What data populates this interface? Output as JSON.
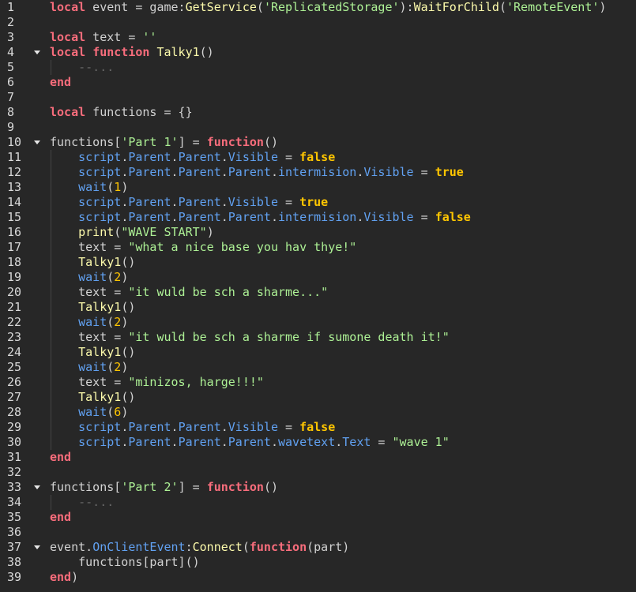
{
  "editor": {
    "colors": {
      "background": "#272727",
      "keyword": "#f86d7c",
      "boolean": "#ffc600",
      "function": "#fdfbac",
      "property": "#61a1f1",
      "string": "#adf195",
      "number": "#ffc600",
      "comment": "#666666",
      "text": "#d2d2d2",
      "line_number": "#d8d8d8"
    },
    "fold_lines": [
      4,
      10,
      33,
      37
    ],
    "lines": [
      {
        "n": "1",
        "tokens": [
          [
            "kw",
            "local"
          ],
          [
            "plain",
            " event = game:"
          ],
          [
            "fn",
            "GetService"
          ],
          [
            "plain",
            "("
          ],
          [
            "str",
            "'ReplicatedStorage'"
          ],
          [
            "plain",
            "):"
          ],
          [
            "fn",
            "WaitForChild"
          ],
          [
            "plain",
            "("
          ],
          [
            "str",
            "'RemoteEvent'"
          ],
          [
            "plain",
            ")"
          ]
        ]
      },
      {
        "n": "2",
        "tokens": []
      },
      {
        "n": "3",
        "tokens": [
          [
            "kw",
            "local"
          ],
          [
            "plain",
            " text = "
          ],
          [
            "str",
            "''"
          ]
        ]
      },
      {
        "n": "4",
        "tokens": [
          [
            "kw",
            "local"
          ],
          [
            "plain",
            " "
          ],
          [
            "kw",
            "function"
          ],
          [
            "plain",
            " "
          ],
          [
            "fn",
            "Talky1"
          ],
          [
            "plain",
            "()"
          ]
        ]
      },
      {
        "n": "5",
        "tokens": [
          [
            "plain",
            "    "
          ],
          [
            "cmt",
            "--..."
          ]
        ]
      },
      {
        "n": "6",
        "tokens": [
          [
            "kw",
            "end"
          ]
        ]
      },
      {
        "n": "7",
        "tokens": []
      },
      {
        "n": "8",
        "tokens": [
          [
            "kw",
            "local"
          ],
          [
            "plain",
            " functions = {}"
          ]
        ]
      },
      {
        "n": "9",
        "tokens": []
      },
      {
        "n": "10",
        "tokens": [
          [
            "plain",
            "functions["
          ],
          [
            "str",
            "'Part 1'"
          ],
          [
            "plain",
            "] = "
          ],
          [
            "kw",
            "function"
          ],
          [
            "plain",
            "()"
          ]
        ]
      },
      {
        "n": "11",
        "tokens": [
          [
            "plain",
            "    "
          ],
          [
            "prop",
            "script"
          ],
          [
            "plain",
            "."
          ],
          [
            "prop",
            "Parent"
          ],
          [
            "plain",
            "."
          ],
          [
            "prop",
            "Parent"
          ],
          [
            "plain",
            "."
          ],
          [
            "prop",
            "Visible"
          ],
          [
            "plain",
            " = "
          ],
          [
            "bool",
            "false"
          ]
        ]
      },
      {
        "n": "12",
        "tokens": [
          [
            "plain",
            "    "
          ],
          [
            "prop",
            "script"
          ],
          [
            "plain",
            "."
          ],
          [
            "prop",
            "Parent"
          ],
          [
            "plain",
            "."
          ],
          [
            "prop",
            "Parent"
          ],
          [
            "plain",
            "."
          ],
          [
            "prop",
            "Parent"
          ],
          [
            "plain",
            "."
          ],
          [
            "prop",
            "intermision"
          ],
          [
            "plain",
            "."
          ],
          [
            "prop",
            "Visible"
          ],
          [
            "plain",
            " = "
          ],
          [
            "bool",
            "true"
          ]
        ]
      },
      {
        "n": "13",
        "tokens": [
          [
            "plain",
            "    "
          ],
          [
            "prop",
            "wait"
          ],
          [
            "plain",
            "("
          ],
          [
            "num",
            "1"
          ],
          [
            "plain",
            ")"
          ]
        ]
      },
      {
        "n": "14",
        "tokens": [
          [
            "plain",
            "    "
          ],
          [
            "prop",
            "script"
          ],
          [
            "plain",
            "."
          ],
          [
            "prop",
            "Parent"
          ],
          [
            "plain",
            "."
          ],
          [
            "prop",
            "Parent"
          ],
          [
            "plain",
            "."
          ],
          [
            "prop",
            "Visible"
          ],
          [
            "plain",
            " = "
          ],
          [
            "bool",
            "true"
          ]
        ]
      },
      {
        "n": "15",
        "tokens": [
          [
            "plain",
            "    "
          ],
          [
            "prop",
            "script"
          ],
          [
            "plain",
            "."
          ],
          [
            "prop",
            "Parent"
          ],
          [
            "plain",
            "."
          ],
          [
            "prop",
            "Parent"
          ],
          [
            "plain",
            "."
          ],
          [
            "prop",
            "Parent"
          ],
          [
            "plain",
            "."
          ],
          [
            "prop",
            "intermision"
          ],
          [
            "plain",
            "."
          ],
          [
            "prop",
            "Visible"
          ],
          [
            "plain",
            " = "
          ],
          [
            "bool",
            "false"
          ]
        ]
      },
      {
        "n": "16",
        "tokens": [
          [
            "plain",
            "    "
          ],
          [
            "fn",
            "print"
          ],
          [
            "plain",
            "("
          ],
          [
            "str",
            "\"WAVE START\""
          ],
          [
            "plain",
            ")"
          ]
        ]
      },
      {
        "n": "17",
        "tokens": [
          [
            "plain",
            "    text = "
          ],
          [
            "str",
            "\"what a nice base you hav thye!\""
          ]
        ]
      },
      {
        "n": "18",
        "tokens": [
          [
            "plain",
            "    "
          ],
          [
            "fn",
            "Talky1"
          ],
          [
            "plain",
            "()"
          ]
        ]
      },
      {
        "n": "19",
        "tokens": [
          [
            "plain",
            "    "
          ],
          [
            "prop",
            "wait"
          ],
          [
            "plain",
            "("
          ],
          [
            "num",
            "2"
          ],
          [
            "plain",
            ")"
          ]
        ]
      },
      {
        "n": "20",
        "tokens": [
          [
            "plain",
            "    text = "
          ],
          [
            "str",
            "\"it wuld be sch a sharme...\""
          ]
        ]
      },
      {
        "n": "21",
        "tokens": [
          [
            "plain",
            "    "
          ],
          [
            "fn",
            "Talky1"
          ],
          [
            "plain",
            "()"
          ]
        ]
      },
      {
        "n": "22",
        "tokens": [
          [
            "plain",
            "    "
          ],
          [
            "prop",
            "wait"
          ],
          [
            "plain",
            "("
          ],
          [
            "num",
            "2"
          ],
          [
            "plain",
            ")"
          ]
        ]
      },
      {
        "n": "23",
        "tokens": [
          [
            "plain",
            "    text = "
          ],
          [
            "str",
            "\"it wuld be sch a sharme if sumone death it!\""
          ]
        ]
      },
      {
        "n": "24",
        "tokens": [
          [
            "plain",
            "    "
          ],
          [
            "fn",
            "Talky1"
          ],
          [
            "plain",
            "()"
          ]
        ]
      },
      {
        "n": "25",
        "tokens": [
          [
            "plain",
            "    "
          ],
          [
            "prop",
            "wait"
          ],
          [
            "plain",
            "("
          ],
          [
            "num",
            "2"
          ],
          [
            "plain",
            ")"
          ]
        ]
      },
      {
        "n": "26",
        "tokens": [
          [
            "plain",
            "    text = "
          ],
          [
            "str",
            "\"minizos, harge!!!\""
          ]
        ]
      },
      {
        "n": "27",
        "tokens": [
          [
            "plain",
            "    "
          ],
          [
            "fn",
            "Talky1"
          ],
          [
            "plain",
            "()"
          ]
        ]
      },
      {
        "n": "28",
        "tokens": [
          [
            "plain",
            "    "
          ],
          [
            "prop",
            "wait"
          ],
          [
            "plain",
            "("
          ],
          [
            "num",
            "6"
          ],
          [
            "plain",
            ")"
          ]
        ]
      },
      {
        "n": "29",
        "tokens": [
          [
            "plain",
            "    "
          ],
          [
            "prop",
            "script"
          ],
          [
            "plain",
            "."
          ],
          [
            "prop",
            "Parent"
          ],
          [
            "plain",
            "."
          ],
          [
            "prop",
            "Parent"
          ],
          [
            "plain",
            "."
          ],
          [
            "prop",
            "Visible"
          ],
          [
            "plain",
            " = "
          ],
          [
            "bool",
            "false"
          ]
        ]
      },
      {
        "n": "30",
        "tokens": [
          [
            "plain",
            "    "
          ],
          [
            "prop",
            "script"
          ],
          [
            "plain",
            "."
          ],
          [
            "prop",
            "Parent"
          ],
          [
            "plain",
            "."
          ],
          [
            "prop",
            "Parent"
          ],
          [
            "plain",
            "."
          ],
          [
            "prop",
            "Parent"
          ],
          [
            "plain",
            "."
          ],
          [
            "prop",
            "wavetext"
          ],
          [
            "plain",
            "."
          ],
          [
            "prop",
            "Text"
          ],
          [
            "plain",
            " = "
          ],
          [
            "str",
            "\"wave 1\""
          ]
        ]
      },
      {
        "n": "31",
        "tokens": [
          [
            "kw",
            "end"
          ]
        ]
      },
      {
        "n": "32",
        "tokens": []
      },
      {
        "n": "33",
        "tokens": [
          [
            "plain",
            "functions["
          ],
          [
            "str",
            "'Part 2'"
          ],
          [
            "plain",
            "] = "
          ],
          [
            "kw",
            "function"
          ],
          [
            "plain",
            "()"
          ]
        ]
      },
      {
        "n": "34",
        "tokens": [
          [
            "plain",
            "    "
          ],
          [
            "cmt",
            "--..."
          ]
        ]
      },
      {
        "n": "35",
        "tokens": [
          [
            "kw",
            "end"
          ]
        ]
      },
      {
        "n": "36",
        "tokens": []
      },
      {
        "n": "37",
        "tokens": [
          [
            "plain",
            "event."
          ],
          [
            "prop",
            "OnClientEvent"
          ],
          [
            "plain",
            ":"
          ],
          [
            "fn",
            "Connect"
          ],
          [
            "plain",
            "("
          ],
          [
            "kw",
            "function"
          ],
          [
            "plain",
            "(part)"
          ]
        ]
      },
      {
        "n": "38",
        "tokens": [
          [
            "plain",
            "    functions[part]()"
          ]
        ]
      },
      {
        "n": "39",
        "tokens": [
          [
            "kw",
            "end"
          ],
          [
            "plain",
            ")"
          ]
        ]
      }
    ]
  }
}
